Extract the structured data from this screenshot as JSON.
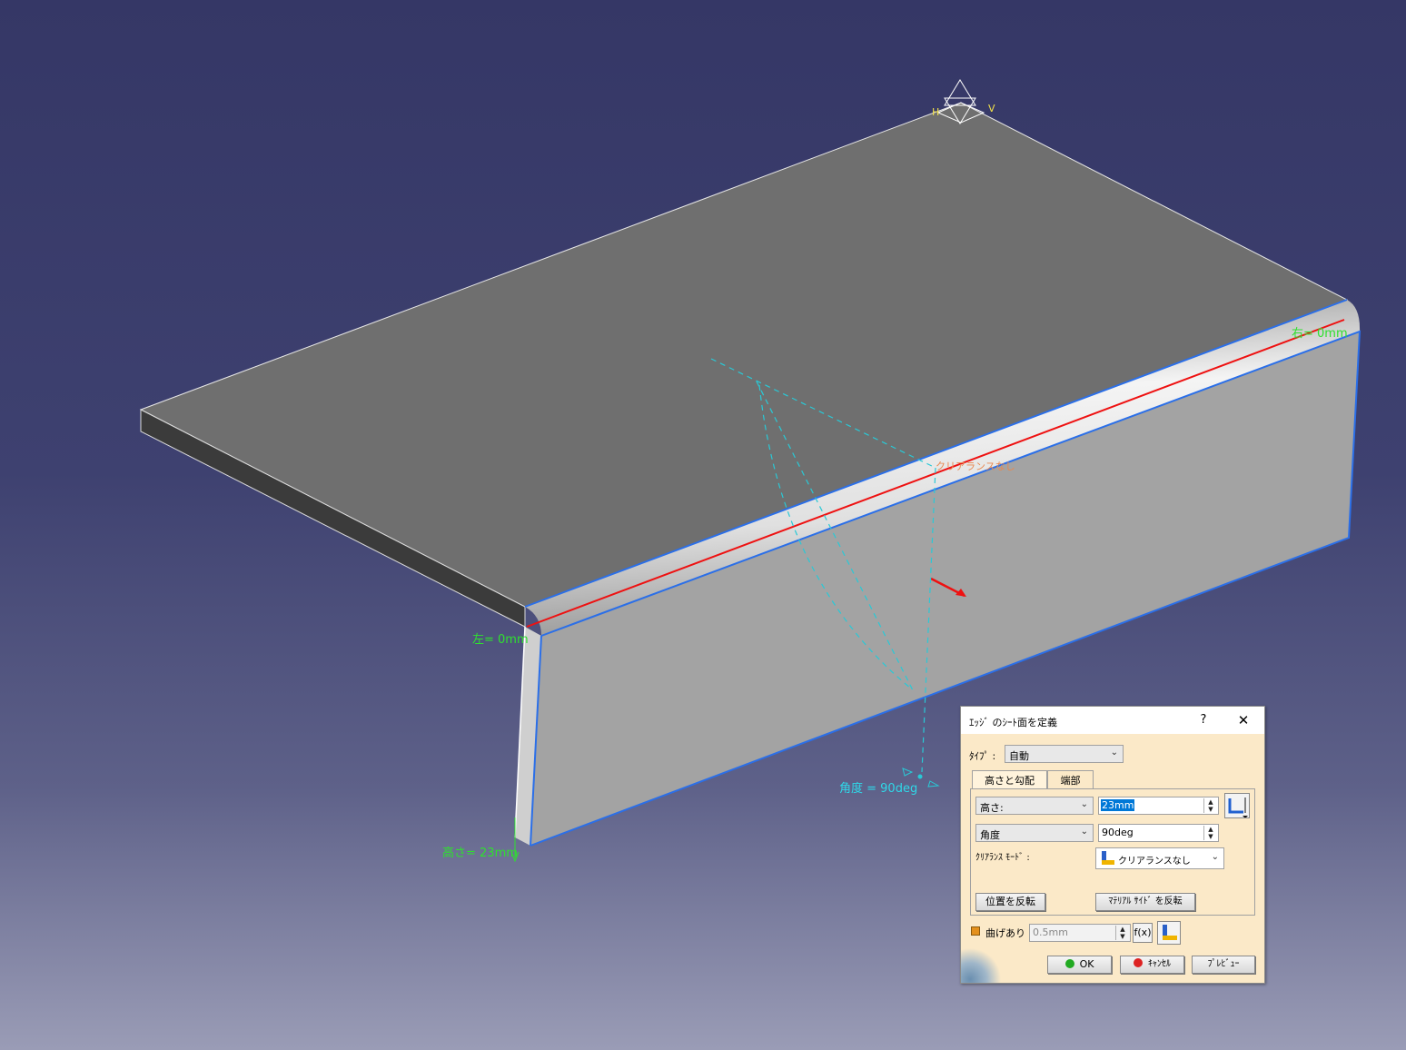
{
  "viewport": {
    "annotations": {
      "right": "右= 0mm",
      "left": "左= 0mm",
      "height": "高さ= 23mm",
      "angle": "角度 = 90deg",
      "clearance": "クリアランスなし",
      "axis_h": "H",
      "axis_v": "V"
    }
  },
  "dialog": {
    "title": "ｴｯｼﾞ のｼｰﾄ面を定義",
    "help_label": "?",
    "close_label": "✕",
    "type_label": "ﾀｲﾌﾟ :",
    "type_value": "自動",
    "tabs": [
      {
        "label": "高さと勾配",
        "active": true
      },
      {
        "label": "端部",
        "active": false
      }
    ],
    "height_mode": "高さ:",
    "height_value": "23mm",
    "angle_mode": "角度",
    "angle_value": "90deg",
    "clearance_label": "ｸﾘｱﾗﾝｽ ﾓｰﾄﾞ :",
    "clearance_value": "クリアランスなし",
    "invert_position_label": "位置を反転",
    "invert_material_label": "ﾏﾃﾘｱﾙ ｻｲﾄﾞ を反転",
    "bend_label": "曲げあり",
    "bend_checked": false,
    "bend_radius_value": "0.5mm",
    "formula_label": "f(x)",
    "ok_label": "OK",
    "cancel_label": "ｷｬﾝｾﾙ",
    "preview_label": "ﾌﾟﾚﾋﾞｭｰ",
    "colors": {
      "background": "#fbe9c8",
      "ok_dot": "#22aa22",
      "cancel_dot": "#dd2222",
      "selection": "#0078d7"
    }
  }
}
